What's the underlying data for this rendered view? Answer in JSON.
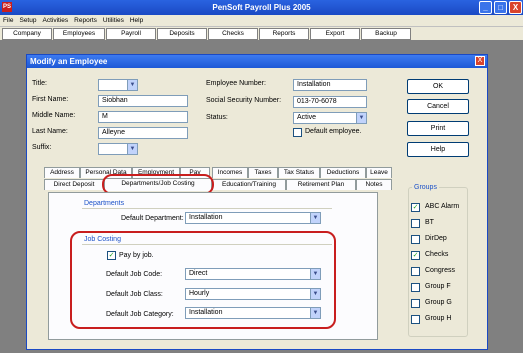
{
  "app": {
    "title": "PenSoft Payroll Plus 2005",
    "icon_text": "PS"
  },
  "window_buttons": {
    "minimize": "_",
    "maximize": "□",
    "close": "X"
  },
  "menu": [
    "File",
    "Setup",
    "Activities",
    "Reports",
    "Utilities",
    "Help"
  ],
  "toolbar": [
    "Company",
    "Employees",
    "Payroll",
    "Deposits",
    "Checks",
    "Reports",
    "Export",
    "Backup"
  ],
  "dialog": {
    "title": "Modify an Employee",
    "close": "X",
    "labels": {
      "title": "Title:",
      "first_name": "First Name:",
      "middle_name": "Middle Name:",
      "last_name": "Last Name:",
      "suffix": "Suffix:",
      "employee_number": "Employee Number:",
      "ssn": "Social Security Number:",
      "status": "Status:",
      "default_employee": "Default employee."
    },
    "values": {
      "title": "",
      "first_name": "Siobhan",
      "middle_name": "M",
      "last_name": "Alleyne",
      "suffix": "",
      "employee_number": "Installation",
      "ssn": "013-70-6078",
      "status": "Active",
      "default_employee_checked": false
    },
    "buttons": {
      "ok": "OK",
      "cancel": "Cancel",
      "print": "Print",
      "help": "Help"
    },
    "tabs_row1": [
      "Address",
      "Personal Data",
      "Employment",
      "Pay",
      "Incomes",
      "Taxes",
      "Tax Status",
      "Deductions",
      "Leave"
    ],
    "tabs_row2": [
      "Direct Deposit",
      "Departments/Job Costing",
      "Education/Training",
      "Retirement Plan",
      "Notes"
    ],
    "active_tab": "Departments/Job Costing",
    "departments": {
      "section_title": "Departments",
      "default_department_label": "Default Department:",
      "default_department_value": "Installation"
    },
    "job_costing": {
      "section_title": "Job Costing",
      "pay_by_job_label": "Pay by job.",
      "pay_by_job_checked": true,
      "default_job_code_label": "Default Job Code:",
      "default_job_code_value": "Direct",
      "default_job_class_label": "Default Job Class:",
      "default_job_class_value": "Hourly",
      "default_job_category_label": "Default Job Category:",
      "default_job_category_value": "Installation"
    },
    "groups": {
      "title": "Groups",
      "items": [
        {
          "label": "ABC Alarm",
          "checked": true
        },
        {
          "label": "BT",
          "checked": false
        },
        {
          "label": "DirDep",
          "checked": false
        },
        {
          "label": "Checks",
          "checked": true
        },
        {
          "label": "Congress",
          "checked": false
        },
        {
          "label": "Group F",
          "checked": false
        },
        {
          "label": "Group G",
          "checked": false
        },
        {
          "label": "Group H",
          "checked": false
        }
      ]
    },
    "check_mark": "✓",
    "dropdown_arrow": "▼"
  },
  "colors": {
    "titlebar": "#1a49c4",
    "highlight": "#c81e1e",
    "group_title": "#1c52c8"
  }
}
